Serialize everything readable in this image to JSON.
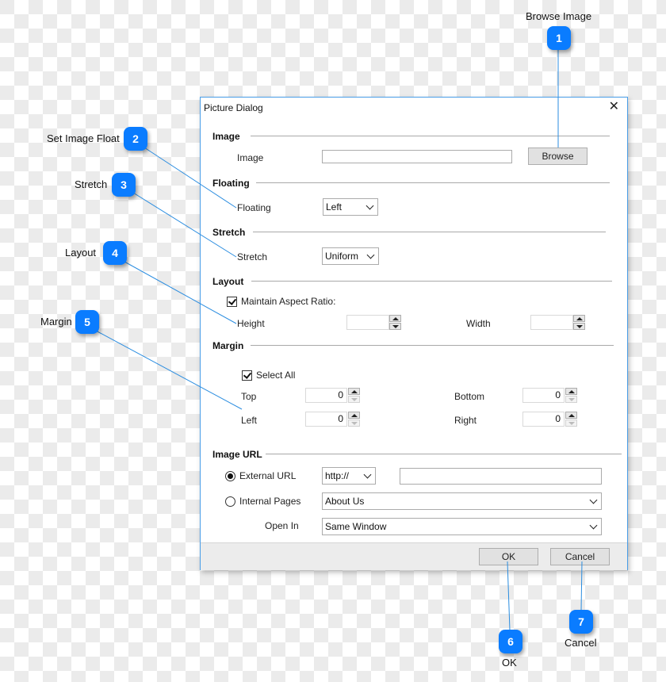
{
  "dialog": {
    "title": "Picture Dialog",
    "close_icon": "close-icon",
    "sections": {
      "image": {
        "heading": "Image",
        "image_label": "Image",
        "image_value": "",
        "browse_label": "Browse"
      },
      "floating": {
        "heading": "Floating",
        "label": "Floating",
        "selected": "Left"
      },
      "stretch": {
        "heading": "Stretch",
        "label": "Stretch",
        "selected": "Uniform"
      },
      "layout": {
        "heading": "Layout",
        "maintain_aspect_label": "Maintain Aspect Ratio:",
        "maintain_aspect_checked": true,
        "height_label": "Height",
        "height_value": "",
        "width_label": "Width",
        "width_value": ""
      },
      "margin": {
        "heading": "Margin",
        "select_all_label": "Select All",
        "select_all_checked": true,
        "top_label": "Top",
        "top_value": "0",
        "bottom_label": "Bottom",
        "bottom_value": "0",
        "left_label": "Left",
        "left_value": "0",
        "right_label": "Right",
        "right_value": "0"
      },
      "image_url": {
        "heading": "Image URL",
        "external_label": "External URL",
        "external_selected": true,
        "protocol_selected": "http://",
        "url_value": "",
        "internal_label": "Internal Pages",
        "internal_selected": false,
        "internal_page_selected": "About Us",
        "open_in_label": "Open In",
        "open_in_selected": "Same Window"
      }
    },
    "footer": {
      "ok_label": "OK",
      "cancel_label": "Cancel"
    }
  },
  "callouts": [
    {
      "number": "1",
      "label": "Browse Image"
    },
    {
      "number": "2",
      "label": "Set Image Float"
    },
    {
      "number": "3",
      "label": "Stretch"
    },
    {
      "number": "4",
      "label": "Layout"
    },
    {
      "number": "5",
      "label": "Margin"
    },
    {
      "number": "6",
      "label": "OK"
    },
    {
      "number": "7",
      "label": "Cancel"
    }
  ],
  "colors": {
    "callout_accent": "#0a7cff",
    "dialog_border": "#4a9ee8",
    "connector_line": "#2b8de0"
  }
}
